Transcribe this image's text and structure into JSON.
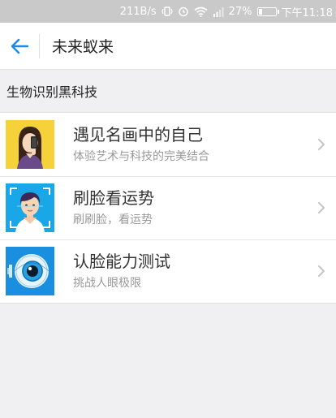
{
  "status_bar": {
    "speed": "211B/s",
    "battery_percent": "27%",
    "battery_level": 0.27,
    "time": "下午11:18",
    "icons": [
      "vibrate-icon",
      "alarm-icon",
      "wifi-icon",
      "signal-icon",
      "battery-icon"
    ]
  },
  "nav": {
    "back_icon": "back-arrow-icon",
    "title": "未来蚁来"
  },
  "section": {
    "title": "生物识别黑科技"
  },
  "items": [
    {
      "title": "遇见名画中的自己",
      "subtitle": "体验艺术与科技的完美结合",
      "thumb_bg": "#f5d23a",
      "icon": "portrait-painting-icon"
    },
    {
      "title": "刷脸看运势",
      "subtitle": "刷刷脸，看运势",
      "thumb_bg": "#1aa7e8",
      "icon": "face-scan-icon"
    },
    {
      "title": "认脸能力测试",
      "subtitle": "挑战人眼极限",
      "thumb_bg": "#1a8fe0",
      "icon": "eye-icon"
    }
  ],
  "colors": {
    "accent": "#1e88e5",
    "page_bg": "#f0f0f2",
    "status_bar_bg": "#c9c9c9"
  }
}
